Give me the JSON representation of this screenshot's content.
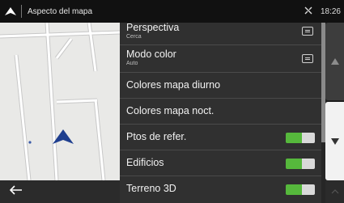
{
  "topbar": {
    "title": "Aspecto del mapa",
    "time": "18:26",
    "icons": [
      "navigation-arrow-icon",
      "signal-icon"
    ]
  },
  "settings": [
    {
      "label": "Perspectiva",
      "value": "Cerca",
      "control": "menu"
    },
    {
      "label": "Modo color",
      "value": "Auto",
      "control": "menu"
    },
    {
      "label": "Colores mapa diurno",
      "control": "none"
    },
    {
      "label": "Colores mapa noct.",
      "control": "none"
    },
    {
      "label": "Ptos de refer.",
      "control": "toggle",
      "on": true
    },
    {
      "label": "Edificios",
      "control": "toggle",
      "on": true
    },
    {
      "label": "Terreno 3D",
      "control": "toggle",
      "on": true
    }
  ],
  "colors": {
    "toggle_on": "#56b83c",
    "list_bg": "#303030",
    "topbar_bg": "#111111",
    "map_bg": "#e9e9e7",
    "position_arrow": "#1f3f8f"
  },
  "controls": {
    "back_icon": "back-arrow-icon",
    "scroll_up_icon": "triangle-up-icon",
    "scroll_down_icon": "triangle-down-icon"
  }
}
